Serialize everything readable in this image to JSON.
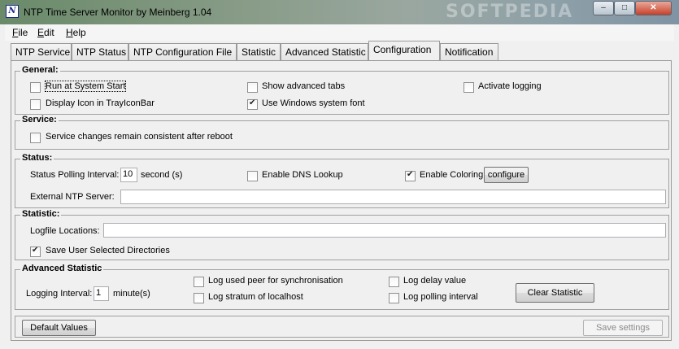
{
  "window": {
    "title": "NTP Time Server Monitor by Meinberg 1.04",
    "icon_name": "meinberg-app-icon",
    "watermark": "SOFTPEDIA",
    "controls": {
      "minimize": "–",
      "maximize": "□",
      "close": "✕"
    }
  },
  "menu": [
    "File",
    "Edit",
    "Help"
  ],
  "tabs": [
    "NTP Service",
    "NTP Status",
    "NTP Configuration File",
    "Statistic",
    "Advanced Statistic",
    "Configuration",
    "Notification"
  ],
  "active_tab": "Configuration",
  "general": {
    "title": "General:",
    "run_at_start": {
      "label": "Run at System Start",
      "checked": false
    },
    "display_icon": {
      "label": "Display Icon in TrayIconBar",
      "checked": false
    },
    "show_advanced_tabs": {
      "label": "Show advanced tabs",
      "checked": false
    },
    "use_windows_font": {
      "label": "Use Windows system font",
      "checked": true
    },
    "activate_logging": {
      "label": "Activate logging",
      "checked": false
    }
  },
  "service": {
    "title": "Service:",
    "consistent": {
      "label": "Service changes remain consistent after reboot",
      "checked": false
    }
  },
  "status": {
    "title": "Status:",
    "polling_label": "Status Polling Interval:",
    "polling_value": "10",
    "polling_unit": "second (s)",
    "dns_lookup": {
      "label": "Enable DNS Lookup",
      "checked": false
    },
    "coloring": {
      "label": "Enable Coloring",
      "checked": true
    },
    "configure_button": "configure",
    "external_label": "External NTP Server:",
    "external_value": ""
  },
  "statistic": {
    "title": "Statistic:",
    "logfile_label": "Logfile Locations:",
    "logfile_value": "",
    "save_dirs": {
      "label": "Save User Selected Directories",
      "checked": true
    }
  },
  "advanced": {
    "title": "Advanced Statistic",
    "interval_label": "Logging Interval:",
    "interval_value": "1",
    "interval_unit": "minute(s)",
    "log_peer": {
      "label": "Log used peer for synchronisation",
      "checked": false
    },
    "log_stratum": {
      "label": "Log stratum of localhost",
      "checked": false
    },
    "log_delay": {
      "label": "Log delay value",
      "checked": false
    },
    "log_polling": {
      "label": "Log polling interval",
      "checked": false
    },
    "clear_button": "Clear Statistic"
  },
  "footer": {
    "default_button": "Default Values",
    "save_button": "Save settings",
    "save_enabled": false
  }
}
